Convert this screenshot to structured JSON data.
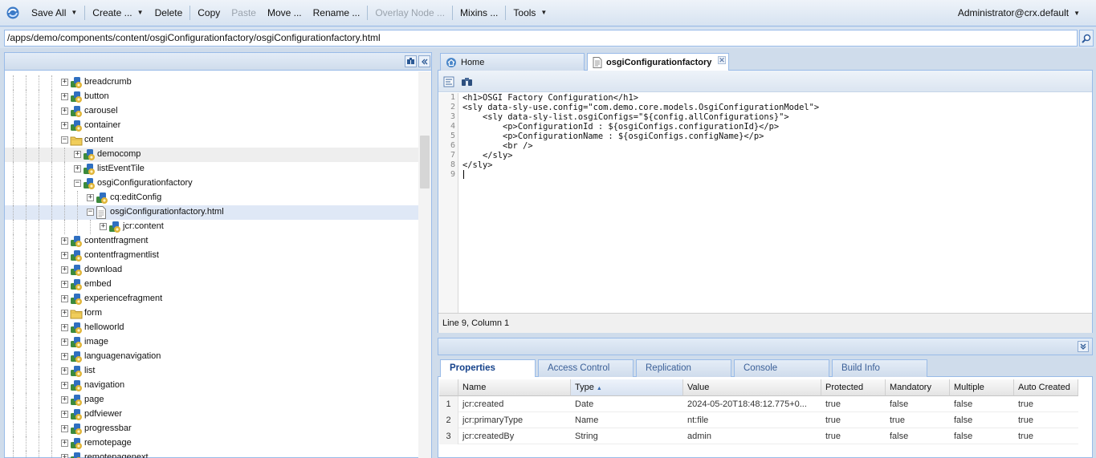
{
  "toolbar": {
    "save_all": "Save All",
    "create": "Create ...",
    "delete": "Delete",
    "copy": "Copy",
    "paste": "Paste",
    "move": "Move ...",
    "rename": "Rename ...",
    "overlay_node": "Overlay Node ...",
    "mixins": "Mixins ...",
    "tools": "Tools",
    "user": "Administrator@crx.default"
  },
  "path": {
    "value": "/apps/demo/components/content/osgiConfigurationfactory/osgiConfigurationfactory.html"
  },
  "tree": {
    "nodes": [
      {
        "label": "breadcrumb",
        "icon": "component-node-icon"
      },
      {
        "label": "button",
        "icon": "component-node-icon"
      },
      {
        "label": "carousel",
        "icon": "component-node-icon"
      },
      {
        "label": "container",
        "icon": "component-node-icon"
      },
      {
        "label": "content",
        "icon": "folder-icon"
      },
      {
        "label": "democomp",
        "icon": "component-node-icon"
      },
      {
        "label": "listEventTile",
        "icon": "component-node-icon"
      },
      {
        "label": "osgiConfigurationfactory",
        "icon": "component-node-icon"
      },
      {
        "label": "cq:editConfig",
        "icon": "component-node-icon"
      },
      {
        "label": "osgiConfigurationfactory.html",
        "icon": "file-icon"
      },
      {
        "label": "jcr:content",
        "icon": "component-node-icon"
      },
      {
        "label": "contentfragment",
        "icon": "component-node-icon"
      },
      {
        "label": "contentfragmentlist",
        "icon": "component-node-icon"
      },
      {
        "label": "download",
        "icon": "component-node-icon"
      },
      {
        "label": "embed",
        "icon": "component-node-icon"
      },
      {
        "label": "experiencefragment",
        "icon": "component-node-icon"
      },
      {
        "label": "form",
        "icon": "folder-icon"
      },
      {
        "label": "helloworld",
        "icon": "component-node-icon"
      },
      {
        "label": "image",
        "icon": "component-node-icon"
      },
      {
        "label": "languagenavigation",
        "icon": "component-node-icon"
      },
      {
        "label": "list",
        "icon": "component-node-icon"
      },
      {
        "label": "navigation",
        "icon": "component-node-icon"
      },
      {
        "label": "page",
        "icon": "component-node-icon"
      },
      {
        "label": "pdfviewer",
        "icon": "component-node-icon"
      },
      {
        "label": "progressbar",
        "icon": "component-node-icon"
      },
      {
        "label": "remotepage",
        "icon": "component-node-icon"
      },
      {
        "label": "remotepagenext",
        "icon": "component-node-icon"
      }
    ]
  },
  "editor": {
    "tabs": [
      {
        "label": "Home"
      },
      {
        "label": "osgiConfigurationfactory"
      }
    ],
    "line_numbers": [
      "1",
      "2",
      "3",
      "4",
      "5",
      "6",
      "7",
      "8",
      "9"
    ],
    "lines": [
      "<h1>OSGI Factory Configuration</h1>",
      "<sly data-sly-use.config=\"com.demo.core.models.OsgiConfigurationModel\">",
      "    <sly data-sly-list.osgiConfigs=\"${config.allConfigurations}\">",
      "        <p>ConfigurationId : ${osgiConfigs.configurationId}</p>",
      "        <p>ConfigurationName : ${osgiConfigs.configName}</p>",
      "        <br />",
      "    </sly>",
      "</sly>",
      ""
    ],
    "status": "Line 9, Column 1"
  },
  "properties": {
    "tabs": [
      {
        "label": "Properties"
      },
      {
        "label": "Access Control"
      },
      {
        "label": "Replication"
      },
      {
        "label": "Console"
      },
      {
        "label": "Build Info"
      }
    ],
    "columns": [
      "Name",
      "Type",
      "Value",
      "Protected",
      "Mandatory",
      "Multiple",
      "Auto Created"
    ],
    "sort_indicator": "▲",
    "rows": [
      {
        "num": "1",
        "name": "jcr:created",
        "type": "Date",
        "value": "2024-05-20T18:48:12.775+0...",
        "protected": "true",
        "mandatory": "false",
        "multiple": "false",
        "auto": "true"
      },
      {
        "num": "2",
        "name": "jcr:primaryType",
        "type": "Name",
        "value": "nt:file",
        "protected": "true",
        "mandatory": "true",
        "multiple": "false",
        "auto": "true"
      },
      {
        "num": "3",
        "name": "jcr:createdBy",
        "type": "String",
        "value": "admin",
        "protected": "true",
        "mandatory": "false",
        "multiple": "false",
        "auto": "true"
      }
    ]
  }
}
